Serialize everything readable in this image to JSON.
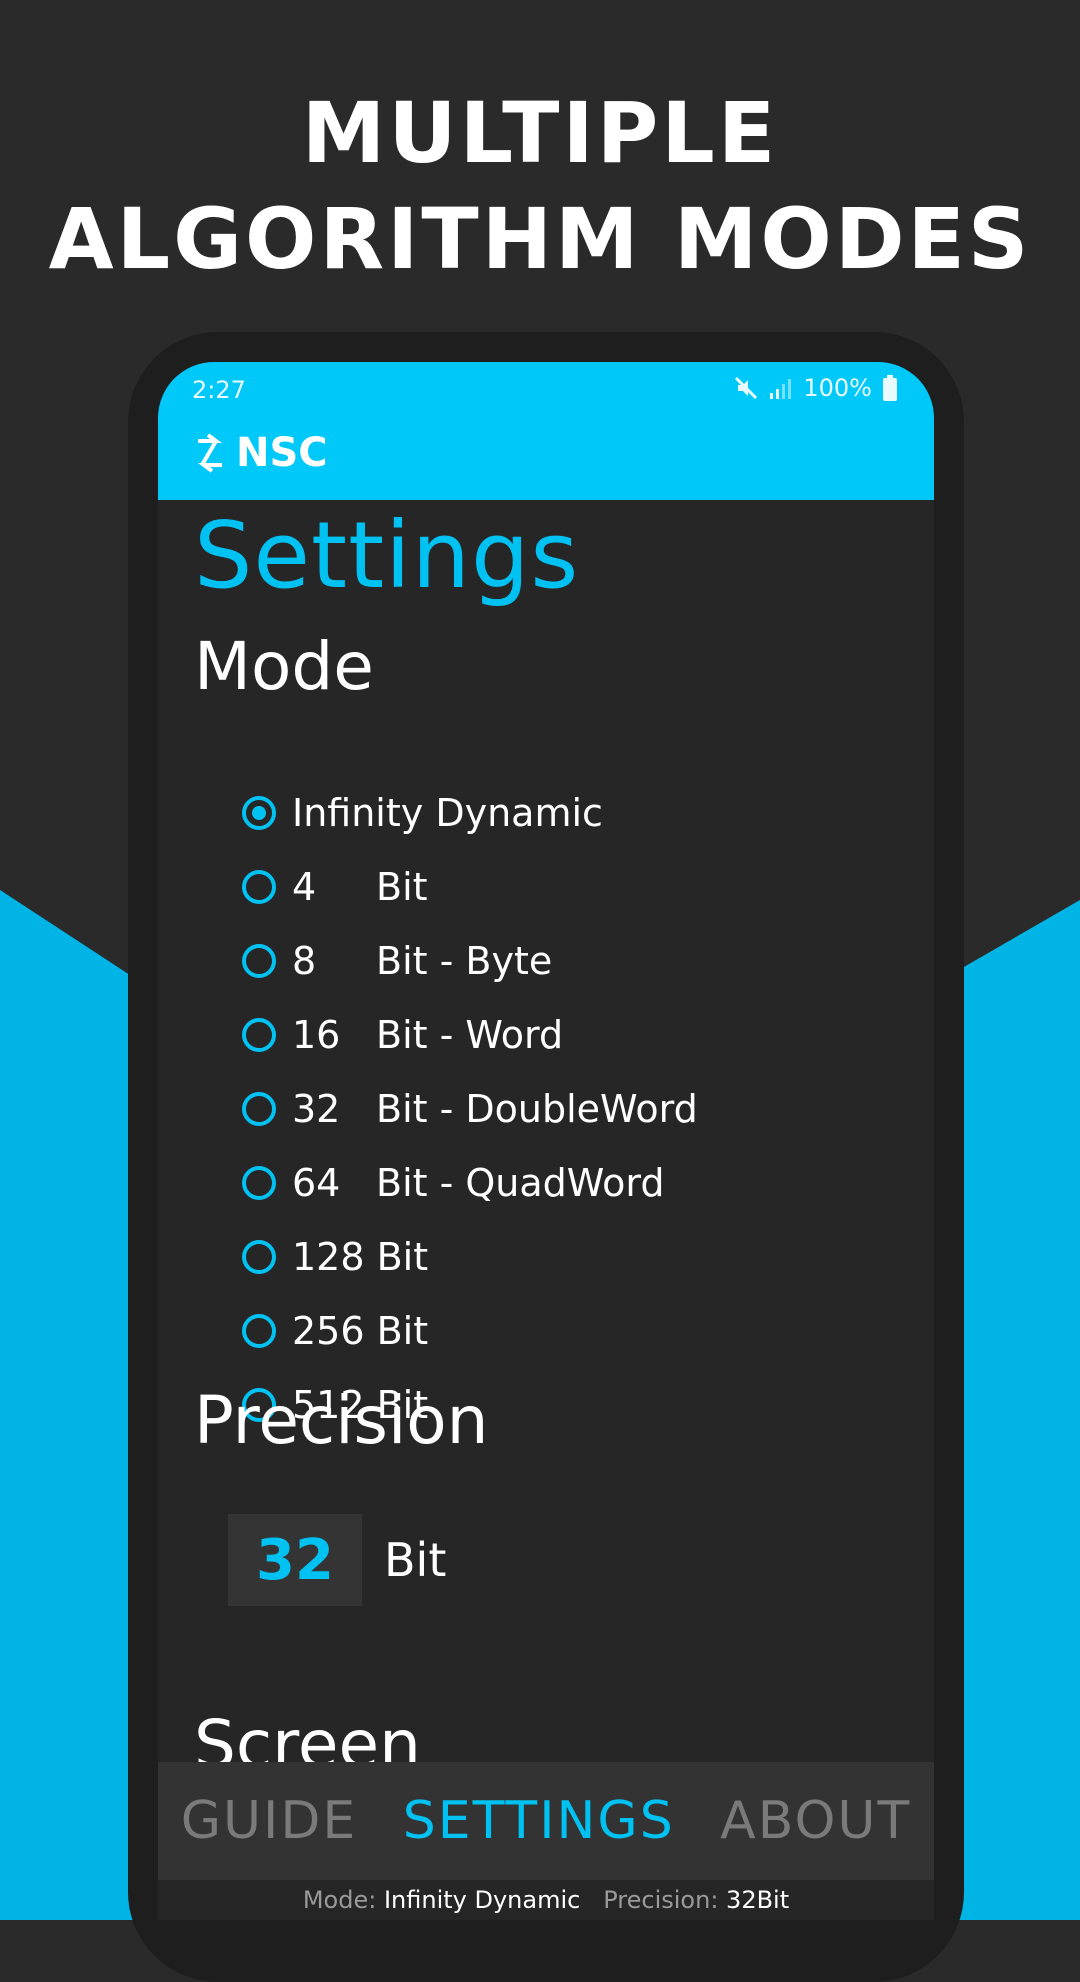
{
  "headline": {
    "line1": "MULTIPLE",
    "line2": "ALGORITHM MODES"
  },
  "status_bar": {
    "time": "2:27",
    "battery": "100%",
    "icons": [
      "mute-icon",
      "signal-icon",
      "battery-icon"
    ]
  },
  "app": {
    "name": "NSC",
    "logo_icon": "swap-arrows-icon"
  },
  "settings": {
    "title": "Settings",
    "mode": {
      "heading": "Mode",
      "selected": "Infinity Dynamic",
      "options": [
        {
          "num": "",
          "label": "Infinity Dynamic",
          "checked": true
        },
        {
          "num": "4",
          "label": "Bit",
          "checked": false
        },
        {
          "num": "8",
          "label": "Bit - Byte",
          "checked": false
        },
        {
          "num": "16",
          "label": "Bit - Word",
          "checked": false
        },
        {
          "num": "32",
          "label": "Bit - DoubleWord",
          "checked": false
        },
        {
          "num": "64",
          "label": "Bit - QuadWord",
          "checked": false
        },
        {
          "num": "",
          "label": "128 Bit",
          "checked": false
        },
        {
          "num": "",
          "label": "256 Bit",
          "checked": false
        },
        {
          "num": "",
          "label": "512 Bit",
          "checked": false
        }
      ]
    },
    "precision": {
      "heading": "Precision",
      "value": "32",
      "unit": "Bit"
    },
    "screen_heading": "Screen"
  },
  "tabs": {
    "guide": "GUIDE",
    "settings": "SETTINGS",
    "about": "ABOUT",
    "active": "SETTINGS"
  },
  "footer": {
    "mode_label": "Mode:",
    "mode_value": "Infinity Dynamic",
    "precision_label": "Precision:",
    "precision_value": "32Bit"
  },
  "colors": {
    "accent": "#00c2f2",
    "appbar": "#00c8f8",
    "background": "#2a2a2a",
    "screen": "#262626",
    "promo_blue": "#00b5e6"
  }
}
